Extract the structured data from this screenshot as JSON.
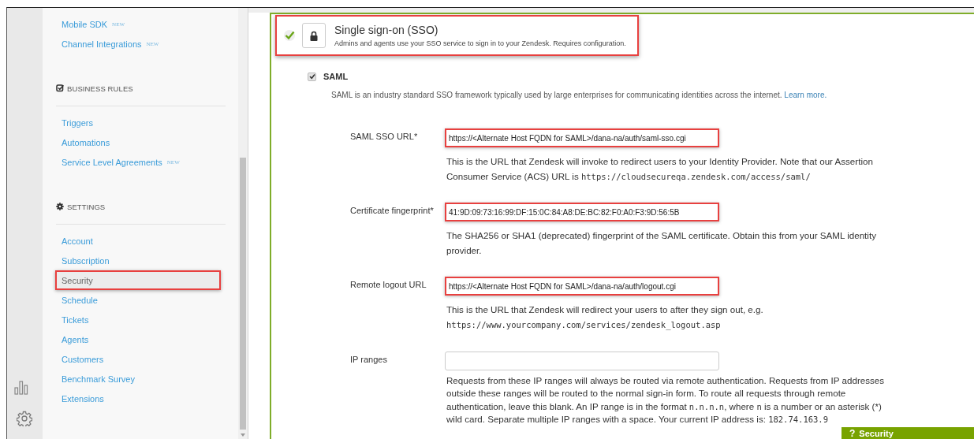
{
  "sidebar": {
    "sections": [
      {
        "items": [
          {
            "label": "Mobile SDK",
            "badge": "NEW",
            "selected": false,
            "highlighted": false
          },
          {
            "label": "Channel Integrations",
            "badge": "NEW",
            "selected": false,
            "highlighted": false
          }
        ]
      },
      {
        "heading": "BUSINESS RULES",
        "items": [
          {
            "label": "Triggers",
            "selected": false,
            "highlighted": false
          },
          {
            "label": "Automations",
            "selected": false,
            "highlighted": false
          },
          {
            "label": "Service Level Agreements",
            "badge": "NEW",
            "selected": false,
            "highlighted": false
          }
        ]
      },
      {
        "heading": "SETTINGS",
        "items": [
          {
            "label": "Account",
            "selected": false,
            "highlighted": false
          },
          {
            "label": "Subscription",
            "selected": false,
            "highlighted": false
          },
          {
            "label": "Security",
            "selected": true,
            "highlighted": true
          },
          {
            "label": "Schedule",
            "selected": false,
            "highlighted": false
          },
          {
            "label": "Tickets",
            "selected": false,
            "highlighted": false
          },
          {
            "label": "Agents",
            "selected": false,
            "highlighted": false
          },
          {
            "label": "Customers",
            "selected": false,
            "highlighted": false
          },
          {
            "label": "Benchmark Survey",
            "selected": false,
            "highlighted": false
          },
          {
            "label": "Extensions",
            "selected": false,
            "highlighted": false
          }
        ]
      }
    ]
  },
  "sso": {
    "enabled": true,
    "highlighted": true,
    "title": "Single sign-on (SSO)",
    "description": "Admins and agents use your SSO service to sign in to your Zendesk. Requires configuration."
  },
  "saml": {
    "label": "SAML",
    "checked": true,
    "description": "SAML is an industry standard SSO framework typically used by large enterprises for communicating identities across the internet.",
    "link": "Learn more."
  },
  "fields": [
    {
      "label": "SAML SSO URL*",
      "value": "https://<Alternate Host FQDN for SAML>/dana-na/auth/saml-sso.cgi",
      "highlighted": true,
      "help": [
        {
          "kind": "text",
          "text": "This is the URL that Zendesk will invoke to redirect users to your Identity Provider. Note that our Assertion Consumer Service (ACS) URL is "
        },
        {
          "kind": "code",
          "text": "https://cloudsecureqa.zendesk.com/access/saml/"
        }
      ]
    },
    {
      "label": "Certificate fingerprint*",
      "value": "41:9D:09:73:16:99:DF:15:0C:84:A8:DE:BC:82:F0:A0:F3:9D:56:5B",
      "highlighted": true,
      "help": [
        {
          "kind": "text",
          "text": "The SHA256 or SHA1 (deprecated) fingerprint of the SAML certificate. Obtain this from your SAML identity provider."
        }
      ]
    },
    {
      "label": "Remote logout URL",
      "value": "https://<Alternate Host FQDN for SAML>/dana-na/auth/logout.cgi",
      "highlighted": true,
      "help": [
        {
          "kind": "text",
          "text": "This is the URL that Zendesk will redirect your users to after they sign out, e.g. "
        },
        {
          "kind": "code",
          "text": "https://www.yourcompany.com/services/zendesk_logout.asp"
        }
      ]
    },
    {
      "label": "IP ranges",
      "highlighted": false,
      "help": [
        {
          "kind": "text",
          "text": "Requests from these IP ranges will always be routed via remote authentication. Requests from IP addresses outside these ranges will be routed to the normal sign-in form. To route all requests through remote authentication, leave this blank. An IP range is in the format "
        },
        {
          "kind": "code",
          "text": "n.n.n.n"
        },
        {
          "kind": "text",
          "text": ", where "
        },
        {
          "kind": "code",
          "text": "n"
        },
        {
          "kind": "text",
          "text": " is a number or an asterisk (*) wild card. Separate multiple IP ranges with a space. Your current IP address is: "
        },
        {
          "kind": "code",
          "text": "182.74.163.9"
        }
      ]
    }
  ],
  "help_tab": {
    "symbol": "?",
    "label": "Security"
  }
}
